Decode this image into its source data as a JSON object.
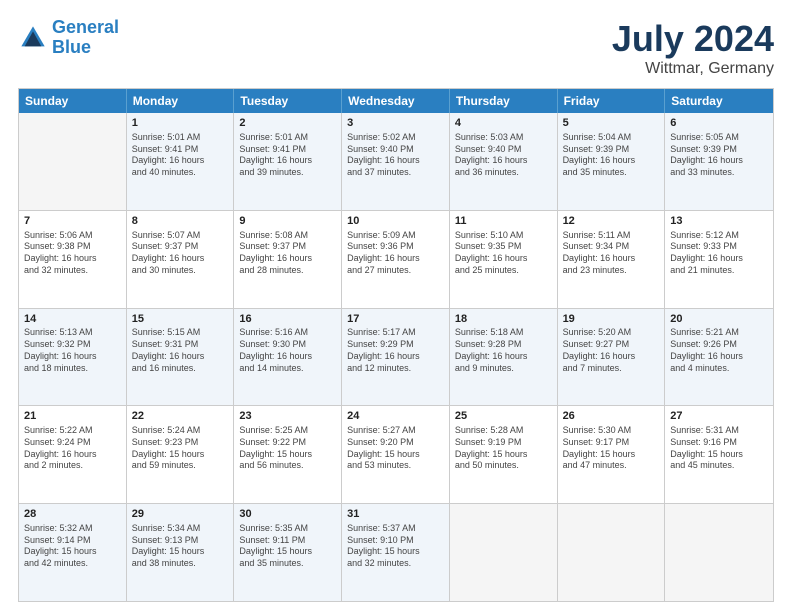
{
  "logo": {
    "line1": "General",
    "line2": "Blue"
  },
  "title": "July 2024",
  "subtitle": "Wittmar, Germany",
  "days": [
    "Sunday",
    "Monday",
    "Tuesday",
    "Wednesday",
    "Thursday",
    "Friday",
    "Saturday"
  ],
  "rows": [
    [
      {
        "num": "",
        "info": ""
      },
      {
        "num": "1",
        "info": "Sunrise: 5:01 AM\nSunset: 9:41 PM\nDaylight: 16 hours\nand 40 minutes."
      },
      {
        "num": "2",
        "info": "Sunrise: 5:01 AM\nSunset: 9:41 PM\nDaylight: 16 hours\nand 39 minutes."
      },
      {
        "num": "3",
        "info": "Sunrise: 5:02 AM\nSunset: 9:40 PM\nDaylight: 16 hours\nand 37 minutes."
      },
      {
        "num": "4",
        "info": "Sunrise: 5:03 AM\nSunset: 9:40 PM\nDaylight: 16 hours\nand 36 minutes."
      },
      {
        "num": "5",
        "info": "Sunrise: 5:04 AM\nSunset: 9:39 PM\nDaylight: 16 hours\nand 35 minutes."
      },
      {
        "num": "6",
        "info": "Sunrise: 5:05 AM\nSunset: 9:39 PM\nDaylight: 16 hours\nand 33 minutes."
      }
    ],
    [
      {
        "num": "7",
        "info": "Sunrise: 5:06 AM\nSunset: 9:38 PM\nDaylight: 16 hours\nand 32 minutes."
      },
      {
        "num": "8",
        "info": "Sunrise: 5:07 AM\nSunset: 9:37 PM\nDaylight: 16 hours\nand 30 minutes."
      },
      {
        "num": "9",
        "info": "Sunrise: 5:08 AM\nSunset: 9:37 PM\nDaylight: 16 hours\nand 28 minutes."
      },
      {
        "num": "10",
        "info": "Sunrise: 5:09 AM\nSunset: 9:36 PM\nDaylight: 16 hours\nand 27 minutes."
      },
      {
        "num": "11",
        "info": "Sunrise: 5:10 AM\nSunset: 9:35 PM\nDaylight: 16 hours\nand 25 minutes."
      },
      {
        "num": "12",
        "info": "Sunrise: 5:11 AM\nSunset: 9:34 PM\nDaylight: 16 hours\nand 23 minutes."
      },
      {
        "num": "13",
        "info": "Sunrise: 5:12 AM\nSunset: 9:33 PM\nDaylight: 16 hours\nand 21 minutes."
      }
    ],
    [
      {
        "num": "14",
        "info": "Sunrise: 5:13 AM\nSunset: 9:32 PM\nDaylight: 16 hours\nand 18 minutes."
      },
      {
        "num": "15",
        "info": "Sunrise: 5:15 AM\nSunset: 9:31 PM\nDaylight: 16 hours\nand 16 minutes."
      },
      {
        "num": "16",
        "info": "Sunrise: 5:16 AM\nSunset: 9:30 PM\nDaylight: 16 hours\nand 14 minutes."
      },
      {
        "num": "17",
        "info": "Sunrise: 5:17 AM\nSunset: 9:29 PM\nDaylight: 16 hours\nand 12 minutes."
      },
      {
        "num": "18",
        "info": "Sunrise: 5:18 AM\nSunset: 9:28 PM\nDaylight: 16 hours\nand 9 minutes."
      },
      {
        "num": "19",
        "info": "Sunrise: 5:20 AM\nSunset: 9:27 PM\nDaylight: 16 hours\nand 7 minutes."
      },
      {
        "num": "20",
        "info": "Sunrise: 5:21 AM\nSunset: 9:26 PM\nDaylight: 16 hours\nand 4 minutes."
      }
    ],
    [
      {
        "num": "21",
        "info": "Sunrise: 5:22 AM\nSunset: 9:24 PM\nDaylight: 16 hours\nand 2 minutes."
      },
      {
        "num": "22",
        "info": "Sunrise: 5:24 AM\nSunset: 9:23 PM\nDaylight: 15 hours\nand 59 minutes."
      },
      {
        "num": "23",
        "info": "Sunrise: 5:25 AM\nSunset: 9:22 PM\nDaylight: 15 hours\nand 56 minutes."
      },
      {
        "num": "24",
        "info": "Sunrise: 5:27 AM\nSunset: 9:20 PM\nDaylight: 15 hours\nand 53 minutes."
      },
      {
        "num": "25",
        "info": "Sunrise: 5:28 AM\nSunset: 9:19 PM\nDaylight: 15 hours\nand 50 minutes."
      },
      {
        "num": "26",
        "info": "Sunrise: 5:30 AM\nSunset: 9:17 PM\nDaylight: 15 hours\nand 47 minutes."
      },
      {
        "num": "27",
        "info": "Sunrise: 5:31 AM\nSunset: 9:16 PM\nDaylight: 15 hours\nand 45 minutes."
      }
    ],
    [
      {
        "num": "28",
        "info": "Sunrise: 5:32 AM\nSunset: 9:14 PM\nDaylight: 15 hours\nand 42 minutes."
      },
      {
        "num": "29",
        "info": "Sunrise: 5:34 AM\nSunset: 9:13 PM\nDaylight: 15 hours\nand 38 minutes."
      },
      {
        "num": "30",
        "info": "Sunrise: 5:35 AM\nSunset: 9:11 PM\nDaylight: 15 hours\nand 35 minutes."
      },
      {
        "num": "31",
        "info": "Sunrise: 5:37 AM\nSunset: 9:10 PM\nDaylight: 15 hours\nand 32 minutes."
      },
      {
        "num": "",
        "info": ""
      },
      {
        "num": "",
        "info": ""
      },
      {
        "num": "",
        "info": ""
      }
    ]
  ],
  "alt_rows": [
    0,
    2,
    4
  ]
}
